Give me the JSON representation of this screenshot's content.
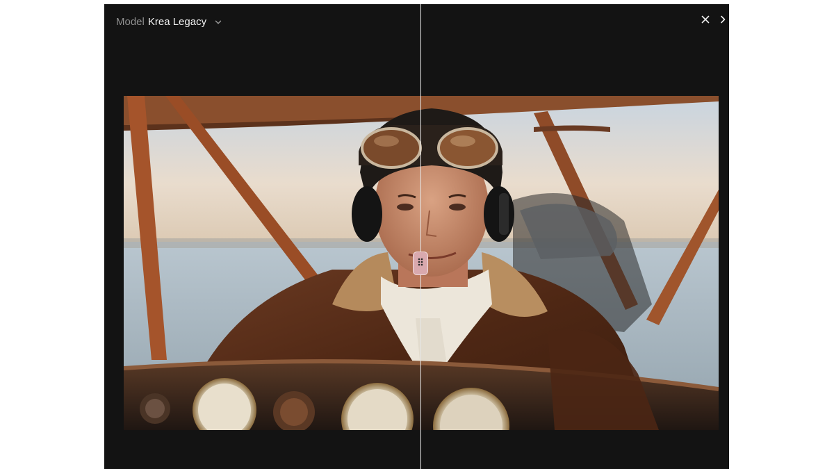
{
  "header": {
    "model_label": "Model",
    "model_name": "Krea Legacy"
  },
  "icons": {
    "dropdown": "chevron-down-icon",
    "close": "close-icon",
    "next": "chevron-right-icon",
    "handle": "drag-handle-icon"
  },
  "colors": {
    "modal_background": "#131313",
    "handle": "#d9a9ae",
    "divider": "#e6e6e6"
  },
  "comparison": {
    "split_fraction": 0.5
  }
}
